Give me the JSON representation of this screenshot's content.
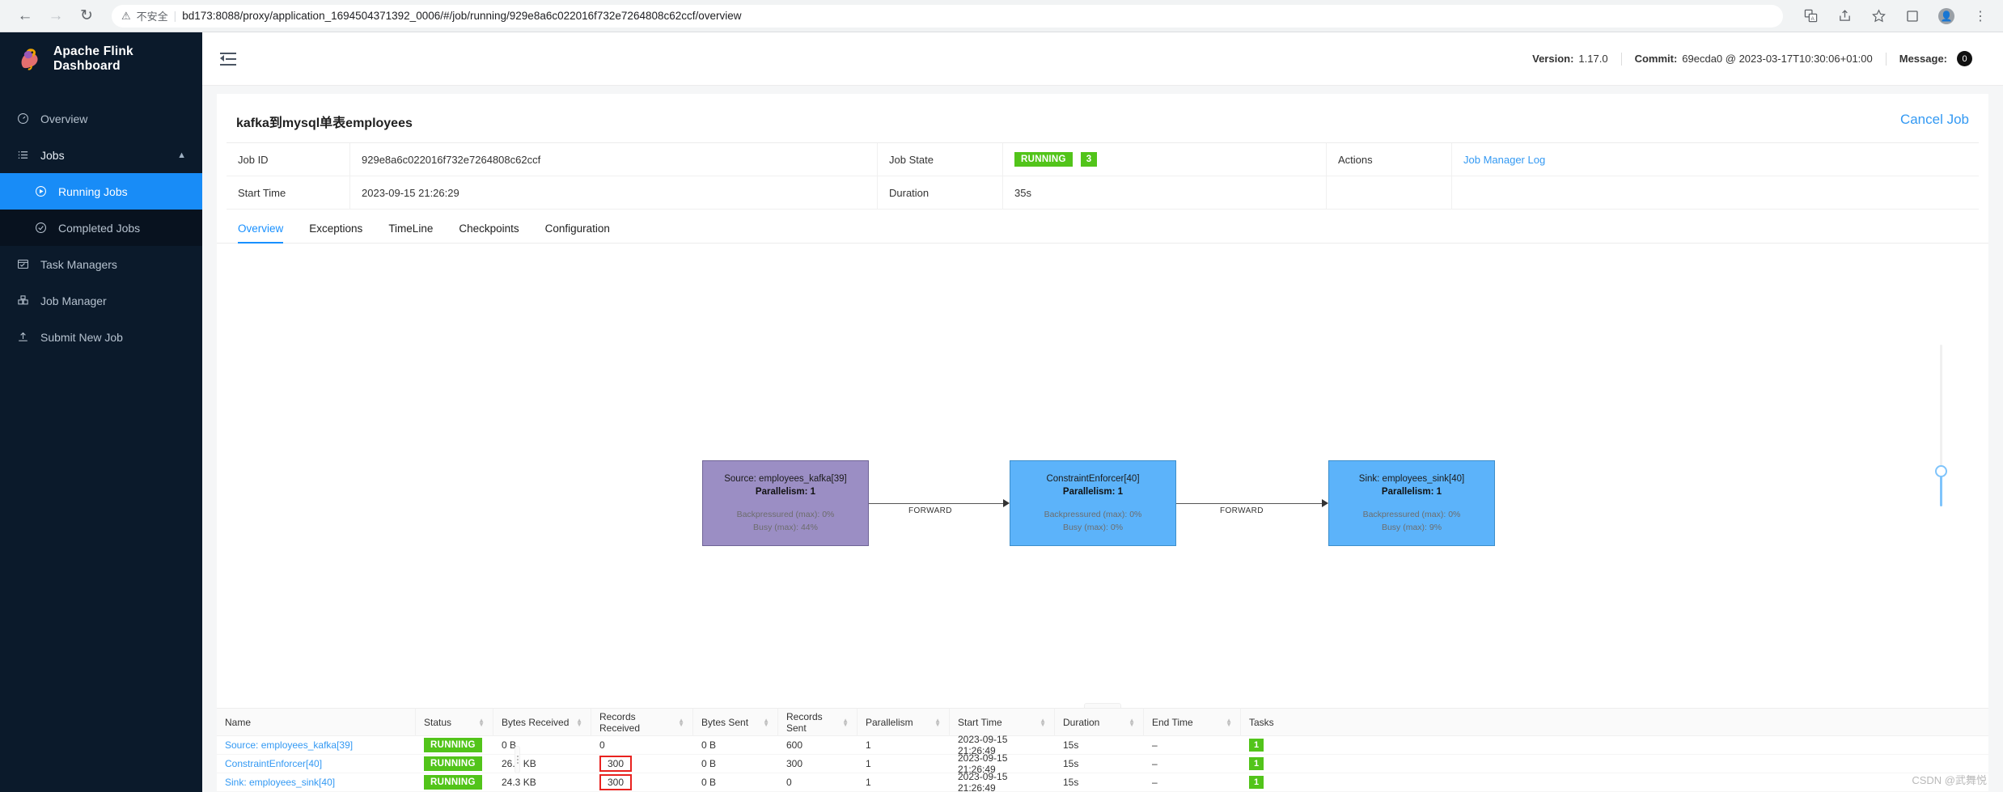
{
  "browser": {
    "back_icon": "back-arrow-icon",
    "forward_icon": "forward-arrow-icon",
    "reload_icon": "reload-icon",
    "security_label": "不安全",
    "url": "bd173:8088/proxy/application_1694504371392_0006/#/job/running/929e8a6c022016f732e7264808c62ccf/overview",
    "icons": [
      "translate-icon",
      "share-icon",
      "bookmark-star-icon",
      "sidepanel-icon",
      "profile-avatar-icon",
      "chrome-menu-icon"
    ]
  },
  "sidebar": {
    "brand": "Apache Flink Dashboard",
    "items": [
      {
        "label": "Overview",
        "icon": "gauge-icon",
        "level": 0,
        "active": false
      },
      {
        "label": "Jobs",
        "icon": "list-icon",
        "level": 0,
        "active": false,
        "expanded": true,
        "caret": "chevron-up-icon"
      },
      {
        "label": "Running Jobs",
        "icon": "play-circle-icon",
        "level": 1,
        "active": true
      },
      {
        "label": "Completed Jobs",
        "icon": "check-circle-icon",
        "level": 1,
        "active": false
      },
      {
        "label": "Task Managers",
        "icon": "task-manager-icon",
        "level": 0,
        "active": false
      },
      {
        "label": "Job Manager",
        "icon": "job-manager-icon",
        "level": 0,
        "active": false
      },
      {
        "label": "Submit New Job",
        "icon": "upload-icon",
        "level": 0,
        "active": false
      }
    ]
  },
  "topbar": {
    "menu_fold_icon": "menu-fold-icon",
    "version_label": "Version:",
    "version_value": "1.17.0",
    "commit_label": "Commit:",
    "commit_value": "69ecda0 @ 2023-03-17T10:30:06+01:00",
    "message_label": "Message:",
    "message_count": "0"
  },
  "job": {
    "title": "kafka到mysql单表employees",
    "cancel_label": "Cancel Job",
    "info": {
      "job_id_label": "Job ID",
      "job_id_value": "929e8a6c022016f732e7264808c62ccf",
      "job_state_label": "Job State",
      "job_state_value": "RUNNING",
      "job_state_count": "3",
      "actions_label": "Actions",
      "actions_link": "Job Manager Log",
      "start_time_label": "Start Time",
      "start_time_value": "2023-09-15 21:26:29",
      "duration_label": "Duration",
      "duration_value": "35s"
    },
    "tabs": [
      {
        "label": "Overview",
        "active": true
      },
      {
        "label": "Exceptions",
        "active": false
      },
      {
        "label": "TimeLine",
        "active": false
      },
      {
        "label": "Checkpoints",
        "active": false
      },
      {
        "label": "Configuration",
        "active": false
      }
    ]
  },
  "graph": {
    "nodes": [
      {
        "title": "Source: employees_kafka[39]",
        "parallelism": "Parallelism: 1",
        "backpressure": "Backpressured (max): 0%",
        "busy": "Busy (max): 44%",
        "color": "#9b8ec4"
      },
      {
        "title": "ConstraintEnforcer[40]",
        "parallelism": "Parallelism: 1",
        "backpressure": "Backpressured (max): 0%",
        "busy": "Busy (max): 0%",
        "color": "#5cb3fa"
      },
      {
        "title": "Sink: employees_sink[40]",
        "parallelism": "Parallelism: 1",
        "backpressure": "Backpressured (max): 0%",
        "busy": "Busy (max): 9%",
        "color": "#5cb3fa"
      }
    ],
    "edges": [
      {
        "label": "FORWARD"
      },
      {
        "label": "FORWARD"
      }
    ],
    "zoom_slider_icon": "zoom-slider-icon",
    "drag_handle_icon": "drag-handle-icon"
  },
  "vertex_table": {
    "columns": [
      {
        "label": "Name",
        "sortable": false
      },
      {
        "label": "Status",
        "sortable": true
      },
      {
        "label": "Bytes Received",
        "sortable": true
      },
      {
        "label": "Records Received",
        "sortable": true
      },
      {
        "label": "Bytes Sent",
        "sortable": true
      },
      {
        "label": "Records Sent",
        "sortable": true
      },
      {
        "label": "Parallelism",
        "sortable": true
      },
      {
        "label": "Start Time",
        "sortable": true
      },
      {
        "label": "Duration",
        "sortable": true
      },
      {
        "label": "End Time",
        "sortable": true
      },
      {
        "label": "Tasks",
        "sortable": false
      }
    ],
    "rows": [
      {
        "name": "Source: employees_kafka[39]",
        "status": "RUNNING",
        "bytes_received": "0 B",
        "records_received": "0",
        "records_received_highlighted": false,
        "bytes_sent": "0 B",
        "records_sent": "600",
        "parallelism": "1",
        "start_time": "2023-09-15 21:26:49",
        "duration": "15s",
        "end_time": "–",
        "tasks": "1"
      },
      {
        "name": "ConstraintEnforcer[40]",
        "status": "RUNNING",
        "bytes_received": "26.6 KB",
        "records_received": "300",
        "records_received_highlighted": true,
        "bytes_sent": "0 B",
        "records_sent": "300",
        "parallelism": "1",
        "start_time": "2023-09-15 21:26:49",
        "duration": "15s",
        "end_time": "–",
        "tasks": "1"
      },
      {
        "name": "Sink: employees_sink[40]",
        "status": "RUNNING",
        "bytes_received": "24.3 KB",
        "records_received": "300",
        "records_received_highlighted": true,
        "bytes_sent": "0 B",
        "records_sent": "0",
        "parallelism": "1",
        "start_time": "2023-09-15 21:26:49",
        "duration": "15s",
        "end_time": "–",
        "tasks": "1"
      }
    ]
  },
  "watermark": "CSDN @武舞悦",
  "colors": {
    "accent": "#1890ff",
    "green": "#52c41a",
    "sidebar": "#0b1a2b",
    "highlight": "#e8221f"
  }
}
